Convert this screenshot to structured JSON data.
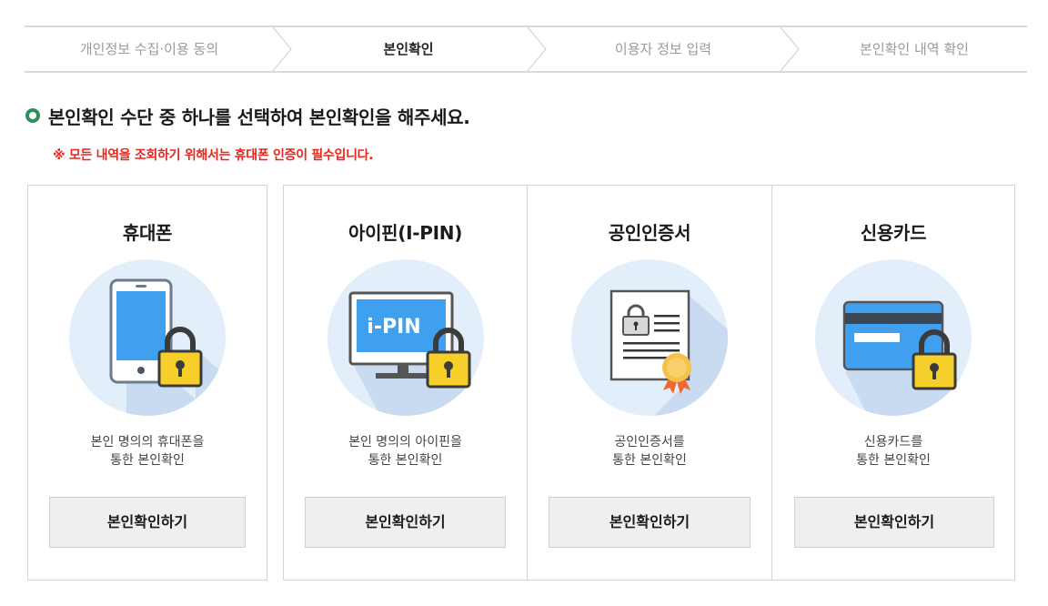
{
  "steps": [
    {
      "label": "개인정보 수집·이용 동의",
      "active": false
    },
    {
      "label": "본인확인",
      "active": true
    },
    {
      "label": "이용자 정보 입력",
      "active": false
    },
    {
      "label": "본인확인 내역 확인",
      "active": false
    }
  ],
  "heading": "본인확인 수단 중 하나를 선택하여 본인확인을 해주세요.",
  "notice": "※ 모든 내역을 조회하기 위해서는 휴대폰 인증이 필수입니다.",
  "methods": [
    {
      "title": "휴대폰",
      "icon": "smartphone-lock-icon",
      "desc_line1": "본인 명의의 휴대폰을",
      "desc_line2": "통한 본인확인",
      "button": "본인확인하기"
    },
    {
      "title": "아이핀(I-PIN)",
      "icon": "ipin-monitor-lock-icon",
      "icon_text": "i-PIN",
      "desc_line1": "본인 명의의 아이핀을",
      "desc_line2": "통한 본인확인",
      "button": "본인확인하기"
    },
    {
      "title": "공인인증서",
      "icon": "certificate-icon",
      "desc_line1": "공인인증서를",
      "desc_line2": "통한 본인확인",
      "button": "본인확인하기"
    },
    {
      "title": "신용카드",
      "icon": "credit-card-lock-icon",
      "desc_line1": "신용카드를",
      "desc_line2": "통한 본인확인",
      "button": "본인확인하기"
    }
  ],
  "colors": {
    "accent_green": "#2f8f56",
    "notice_red": "#e8251e",
    "icon_circle": "#e3eefb",
    "icon_blue": "#3fa0f0",
    "lock_yellow": "#f6cf2b"
  }
}
